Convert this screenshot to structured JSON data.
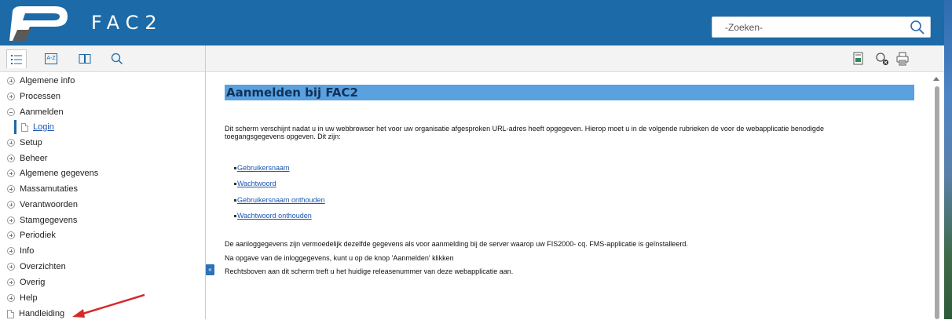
{
  "header": {
    "app_title": "FAC2",
    "search_placeholder": "-Zoeken-"
  },
  "toolbar_left": {
    "tabs": [
      "contents-tab",
      "index-tab",
      "book-tab",
      "search-tab"
    ],
    "index_label": "A-Z"
  },
  "toolbar_right": {
    "icons": [
      "print-topic-icon",
      "remove-highlight-icon",
      "print-icon"
    ]
  },
  "sidebar": {
    "items": [
      {
        "label": "Algemene info",
        "type": "plus"
      },
      {
        "label": "Processen",
        "type": "plus"
      },
      {
        "label": "Aanmelden",
        "type": "minus"
      },
      {
        "label": "Login",
        "type": "page-selected"
      },
      {
        "label": "Setup",
        "type": "plus"
      },
      {
        "label": "Beheer",
        "type": "plus"
      },
      {
        "label": "Algemene gegevens",
        "type": "plus"
      },
      {
        "label": "Massamutaties",
        "type": "plus"
      },
      {
        "label": "Verantwoorden",
        "type": "plus"
      },
      {
        "label": "Stamgegevens",
        "type": "plus"
      },
      {
        "label": "Periodiek",
        "type": "plus"
      },
      {
        "label": "Info",
        "type": "plus"
      },
      {
        "label": "Overzichten",
        "type": "plus"
      },
      {
        "label": "Overig",
        "type": "plus"
      },
      {
        "label": "Help",
        "type": "plus"
      },
      {
        "label": "Handleiding",
        "type": "page"
      }
    ]
  },
  "collapse_label": "«",
  "content": {
    "title": "Aanmelden bij FAC2",
    "intro_line1": "Dit scherm verschijnt nadat u in uw webbrowser het voor uw organisatie afgesproken URL-adres heeft opgegeven. Hierop moet u in de volgende rubrieken de voor de webapplicatie benodigde",
    "intro_line2": "toegangsgegevens opgeven. Dit zijn:",
    "links": [
      "Gebruikersnaam",
      "Wachtwoord",
      "Gebruikersnaam onthouden",
      "Wachtwoord onthouden"
    ],
    "para1": "De aanloggegevens zijn vermoedelijk dezelfde gegevens als voor aanmelding bij de server waarop uw FIS2000- cq. FMS-applicatie is geïnstalleerd.",
    "para2": "Na opgave van de inloggegevens, kunt u op de knop 'Aanmelden' klikken",
    "para3": "Rechtsboven aan dit scherm treft u het huidige releasenummer van deze webapplicatie aan."
  },
  "colors": {
    "header_bg": "#1c6aa7",
    "title_bar": "#5aa1e0",
    "link": "#1a55b0",
    "annotation_arrow": "#d62a2a"
  }
}
